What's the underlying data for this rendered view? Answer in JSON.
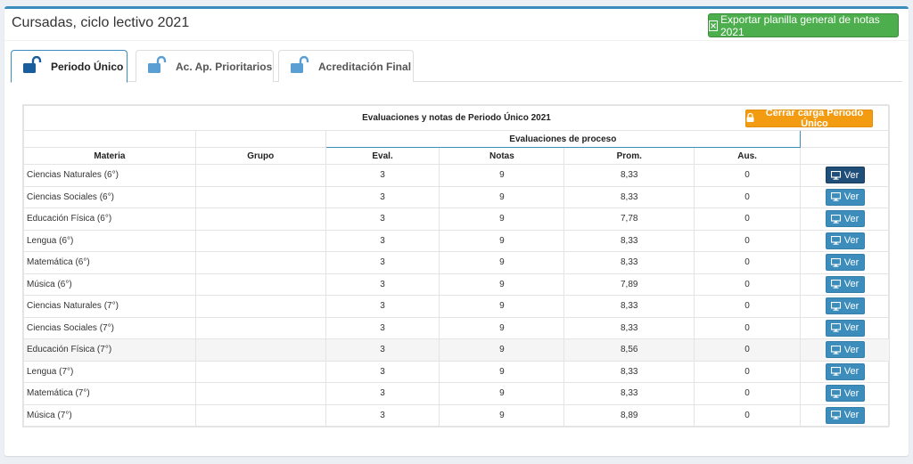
{
  "header": {
    "title": "Cursadas, ciclo lectivo 2021",
    "export_label": "Exportar planilla general de notas 2021"
  },
  "tabs": [
    {
      "label": "Periodo Único",
      "active": true
    },
    {
      "label": "Ac. Ap. Prioritarios",
      "active": false
    },
    {
      "label": "Acreditación Final",
      "active": false
    }
  ],
  "grid": {
    "title": "Evaluaciones y notas de Periodo Único 2021",
    "cerrar_label": "Cerrar carga Periodo Único",
    "group_header": "Evaluaciones de proceso",
    "columns": [
      "Materia",
      "Grupo",
      "Eval.",
      "Notas",
      "Prom.",
      "Aus."
    ],
    "action_label": "Ver",
    "rows": [
      {
        "materia": "Ciencias Naturales (6°)",
        "grupo": "",
        "eval": "3",
        "notas": "9",
        "prom": "8,33",
        "aus": "0"
      },
      {
        "materia": "Ciencias Sociales (6°)",
        "grupo": "",
        "eval": "3",
        "notas": "9",
        "prom": "8,33",
        "aus": "0"
      },
      {
        "materia": "Educación Física (6°)",
        "grupo": "",
        "eval": "3",
        "notas": "9",
        "prom": "7,78",
        "aus": "0"
      },
      {
        "materia": "Lengua (6°)",
        "grupo": "",
        "eval": "3",
        "notas": "9",
        "prom": "8,33",
        "aus": "0"
      },
      {
        "materia": "Matemática (6°)",
        "grupo": "",
        "eval": "3",
        "notas": "9",
        "prom": "8,33",
        "aus": "0"
      },
      {
        "materia": "Música (6°)",
        "grupo": "",
        "eval": "3",
        "notas": "9",
        "prom": "7,89",
        "aus": "0"
      },
      {
        "materia": "Ciencias Naturales (7°)",
        "grupo": "",
        "eval": "3",
        "notas": "9",
        "prom": "8,33",
        "aus": "0"
      },
      {
        "materia": "Ciencias Sociales (7°)",
        "grupo": "",
        "eval": "3",
        "notas": "9",
        "prom": "8,33",
        "aus": "0"
      },
      {
        "materia": "Educación Física (7°)",
        "grupo": "",
        "eval": "3",
        "notas": "9",
        "prom": "8,56",
        "aus": "0"
      },
      {
        "materia": "Lengua (7°)",
        "grupo": "",
        "eval": "3",
        "notas": "9",
        "prom": "8,33",
        "aus": "0"
      },
      {
        "materia": "Matemática (7°)",
        "grupo": "",
        "eval": "3",
        "notas": "9",
        "prom": "8,33",
        "aus": "0"
      },
      {
        "materia": "Música (7°)",
        "grupo": "",
        "eval": "3",
        "notas": "9",
        "prom": "8,89",
        "aus": "0"
      }
    ]
  },
  "icons": {
    "export": "file-excel-icon",
    "tab": "unlock-icon",
    "cerrar": "lock-icon",
    "ver": "monitor-icon"
  },
  "colors": {
    "accent": "#3c8dbc",
    "export_btn": "#4cae4c",
    "cerrar_btn": "#f39c12",
    "ver_btn": "#3c8dbc",
    "ver_btn_hover": "#1f4e79",
    "tab_lock": "#1a5d9c"
  }
}
